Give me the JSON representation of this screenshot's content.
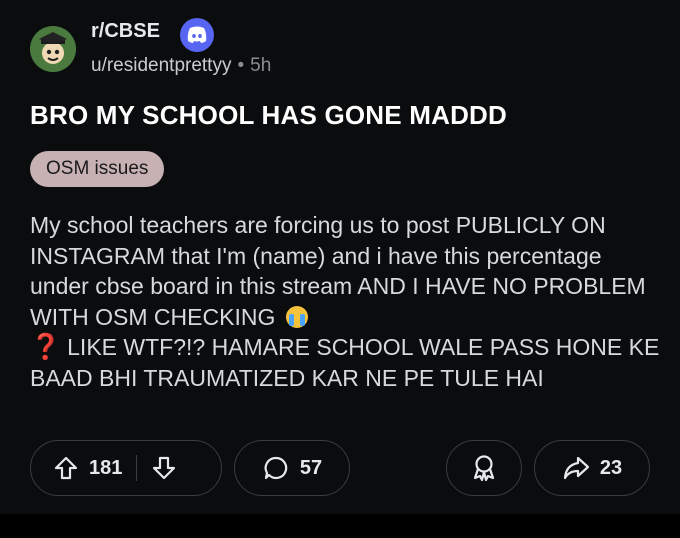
{
  "post": {
    "subreddit": "r/CBSE",
    "author": "u/residentprettyy",
    "separator": "•",
    "age": "5h",
    "title": "BRO MY SCHOOL HAS GONE MADDD",
    "flair": "OSM issues",
    "body_line1": "My school teachers are forcing us to post PUBLICLY ON INSTAGRAM that I'm (name) and i have this percentage under cbse board in this stream AND I HAVE NO PROBLEM WITH OSM CHECKING",
    "body_q": "❓",
    "body_line2": "LIKE WTF?!? HAMARE SCHOOL WALE PASS HONE KE BAAD BHI TRAUMATIZED KAR NE PE TULE HAI"
  },
  "actions": {
    "upvotes": "181",
    "comments": "57",
    "shares": "23"
  },
  "icons": {
    "avatar": "subreddit-avatar-icon",
    "discord": "discord-icon",
    "upvote": "upvote-arrow-icon",
    "downvote": "downvote-arrow-icon",
    "comment": "comment-bubble-icon",
    "award": "award-ribbon-icon",
    "share": "share-arrow-icon",
    "crying_emoji": "crying-face-emoji"
  },
  "colors": {
    "background": "#0b0c0e",
    "flair_bg": "#c7b1b3",
    "discord": "#5865f2"
  }
}
